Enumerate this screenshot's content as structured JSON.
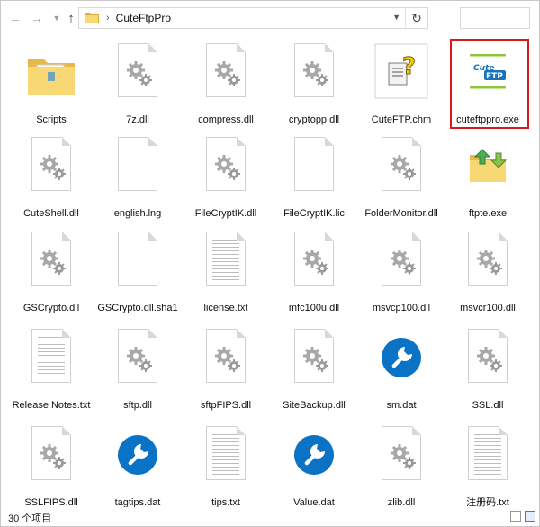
{
  "window": {
    "address_path": "CuteFtpPro",
    "search_placeholder": ""
  },
  "icons": {
    "back": "back-arrow-icon",
    "forward": "forward-arrow-icon",
    "up": "up-arrow-icon",
    "refresh": "refresh-icon"
  },
  "files": [
    {
      "name": "Scripts",
      "type": "folder"
    },
    {
      "name": "7z.dll",
      "type": "dll"
    },
    {
      "name": "compress.dll",
      "type": "dll"
    },
    {
      "name": "cryptopp.dll",
      "type": "dll"
    },
    {
      "name": "CuteFTP.chm",
      "type": "chm"
    },
    {
      "name": "cuteftppro.exe",
      "type": "cuteftp-exe",
      "selected": true
    },
    {
      "name": "CuteShell.dll",
      "type": "dll"
    },
    {
      "name": "english.lng",
      "type": "blank"
    },
    {
      "name": "FileCryptIK.dll",
      "type": "dll"
    },
    {
      "name": "FileCryptIK.lic",
      "type": "blank"
    },
    {
      "name": "FolderMonitor.dll",
      "type": "dll"
    },
    {
      "name": "ftpte.exe",
      "type": "ftpte-exe"
    },
    {
      "name": "GSCrypto.dll",
      "type": "dll"
    },
    {
      "name": "GSCrypto.dll.sha1",
      "type": "blank"
    },
    {
      "name": "license.txt",
      "type": "txt"
    },
    {
      "name": "mfc100u.dll",
      "type": "dll"
    },
    {
      "name": "msvcp100.dll",
      "type": "dll"
    },
    {
      "name": "msvcr100.dll",
      "type": "dll"
    },
    {
      "name": "Release Notes.txt",
      "type": "txt"
    },
    {
      "name": "sftp.dll",
      "type": "dll"
    },
    {
      "name": "sftpFIPS.dll",
      "type": "dll"
    },
    {
      "name": "SiteBackup.dll",
      "type": "dll"
    },
    {
      "name": "sm.dat",
      "type": "dat"
    },
    {
      "name": "SSL.dll",
      "type": "dll"
    },
    {
      "name": "SSLFIPS.dll",
      "type": "dll"
    },
    {
      "name": "tagtips.dat",
      "type": "dat"
    },
    {
      "name": "tips.txt",
      "type": "txt"
    },
    {
      "name": "Value.dat",
      "type": "dat"
    },
    {
      "name": "zlib.dll",
      "type": "dll"
    },
    {
      "name": "注册码.txt",
      "type": "txt"
    }
  ],
  "status": {
    "item_count": "30 个项目"
  },
  "colors": {
    "selection_border": "#d7191c",
    "folder": "#f8d775",
    "wrench_circle": "#0a73c6",
    "gear": "#a8a8a8"
  }
}
